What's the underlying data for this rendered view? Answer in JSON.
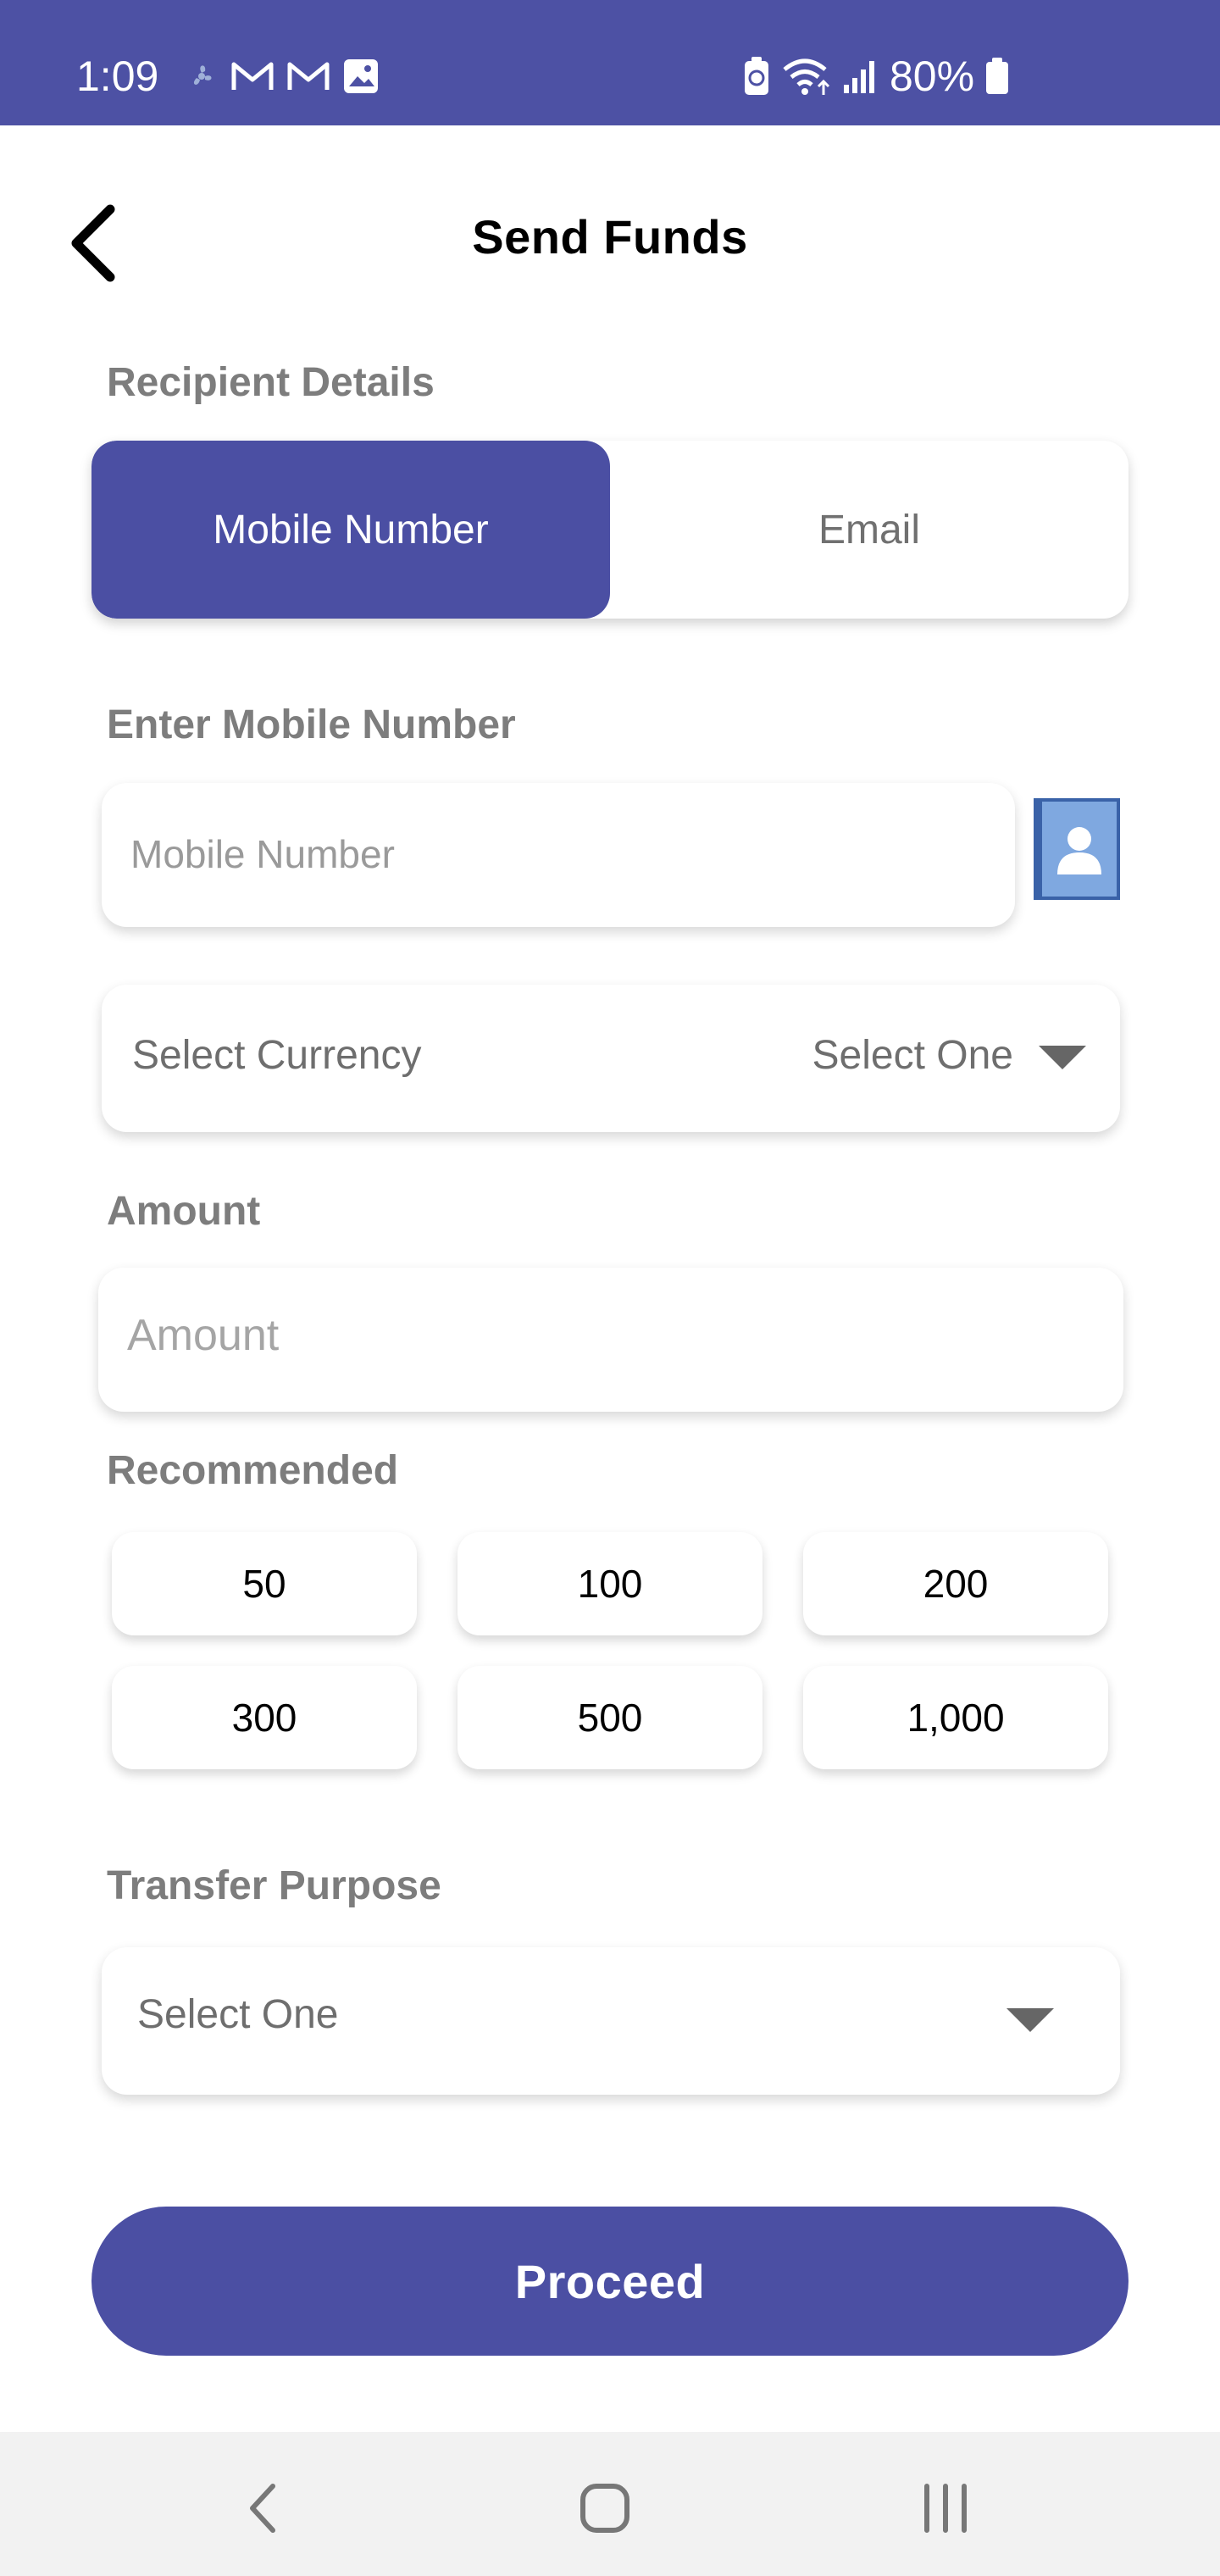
{
  "status_bar": {
    "time": "1:09",
    "battery": "80%",
    "left_icons": [
      "fan-icon",
      "gmail-icon",
      "gmail-icon",
      "image-icon"
    ],
    "right_icons": [
      "battery-saver-icon",
      "wifi-icon",
      "signal-icon",
      "battery-icon"
    ],
    "background": "#4d51a4"
  },
  "header": {
    "title": "Send Funds",
    "back_icon": "chevron-left-icon"
  },
  "recipient": {
    "label": "Recipient Details",
    "tabs": [
      {
        "label": "Mobile Number",
        "active": true
      },
      {
        "label": "Email",
        "active": false
      }
    ]
  },
  "mobile": {
    "label": "Enter Mobile Number",
    "placeholder": "Mobile Number",
    "contact_icon": "contact-book-icon"
  },
  "currency": {
    "label": "Select Currency",
    "value": "Select One"
  },
  "amount": {
    "label": "Amount",
    "placeholder": "Amount"
  },
  "recommended": {
    "label": "Recommended",
    "values": [
      "50",
      "100",
      "200",
      "300",
      "500",
      "1,000"
    ]
  },
  "purpose": {
    "label": "Transfer Purpose",
    "value": "Select One"
  },
  "proceed": {
    "label": "Proceed"
  },
  "nav": {
    "back_icon": "nav-back-icon",
    "home_icon": "nav-home-icon",
    "recents_icon": "nav-recents-icon"
  },
  "colors": {
    "primary": "#4b4fa3",
    "label_gray": "#7d7d7d"
  }
}
